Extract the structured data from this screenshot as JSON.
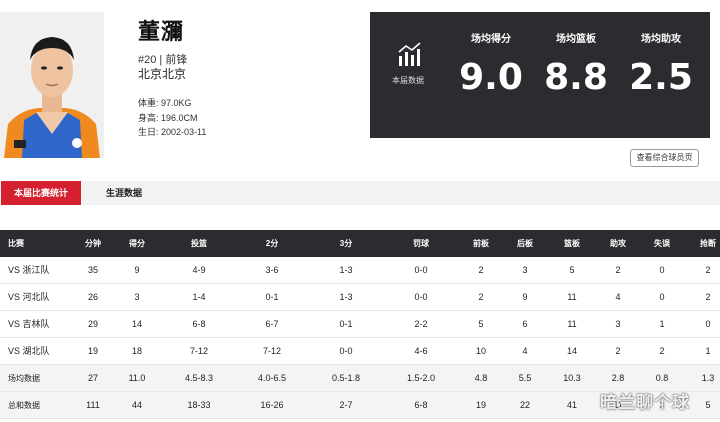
{
  "player": {
    "name": "董瀰",
    "number_position": "#20 | 前锋",
    "team": "北京北京",
    "weight_label": "体重:",
    "weight": "97.0KG",
    "height_label": "身高:",
    "height": "196.0CM",
    "birthday_label": "生日:",
    "birthday": "2002-03-11"
  },
  "season_stats": {
    "icon": "bar-chart-icon",
    "icon_label": "本届数据",
    "items": [
      {
        "label": "场均得分",
        "value": "9.0"
      },
      {
        "label": "场均篮板",
        "value": "8.8"
      },
      {
        "label": "场均助攻",
        "value": "2.5"
      }
    ]
  },
  "profile_button": "查看综合球员页",
  "tabs": [
    {
      "label": "本届比赛统计",
      "active": true
    },
    {
      "label": "生涯数据",
      "active": false
    }
  ],
  "table": {
    "headers": [
      "比赛",
      "分钟",
      "得分",
      "投篮",
      "2分",
      "3分",
      "罚球",
      "前板",
      "后板",
      "篮板",
      "助攻",
      "失误",
      "抢断"
    ],
    "rows": [
      [
        "VS 浙江队",
        "35",
        "9",
        "4-9",
        "3-6",
        "1-3",
        "0-0",
        "2",
        "3",
        "5",
        "2",
        "0",
        "2"
      ],
      [
        "VS 河北队",
        "26",
        "3",
        "1-4",
        "0-1",
        "1-3",
        "0-0",
        "2",
        "9",
        "11",
        "4",
        "0",
        "2"
      ],
      [
        "VS 吉林队",
        "29",
        "14",
        "6-8",
        "6-7",
        "0-1",
        "2-2",
        "5",
        "6",
        "11",
        "3",
        "1",
        "0"
      ],
      [
        "VS 湖北队",
        "19",
        "18",
        "7-12",
        "7-12",
        "0-0",
        "4-6",
        "10",
        "4",
        "14",
        "2",
        "2",
        "1"
      ],
      [
        "场均数据",
        "27",
        "11.0",
        "4.5-8.3",
        "4.0-6.5",
        "0.5-1.8",
        "1.5-2.0",
        "4.8",
        "5.5",
        "10.3",
        "2.8",
        "0.8",
        "1.3"
      ],
      [
        "总和数据",
        "111",
        "44",
        "18-33",
        "16-26",
        "2-7",
        "6-8",
        "19",
        "22",
        "41",
        "11",
        "3",
        "5"
      ]
    ]
  },
  "watermark": "暗兰聊个球",
  "colors": {
    "accent": "#d4202f",
    "dark": "#2b2c2f"
  }
}
